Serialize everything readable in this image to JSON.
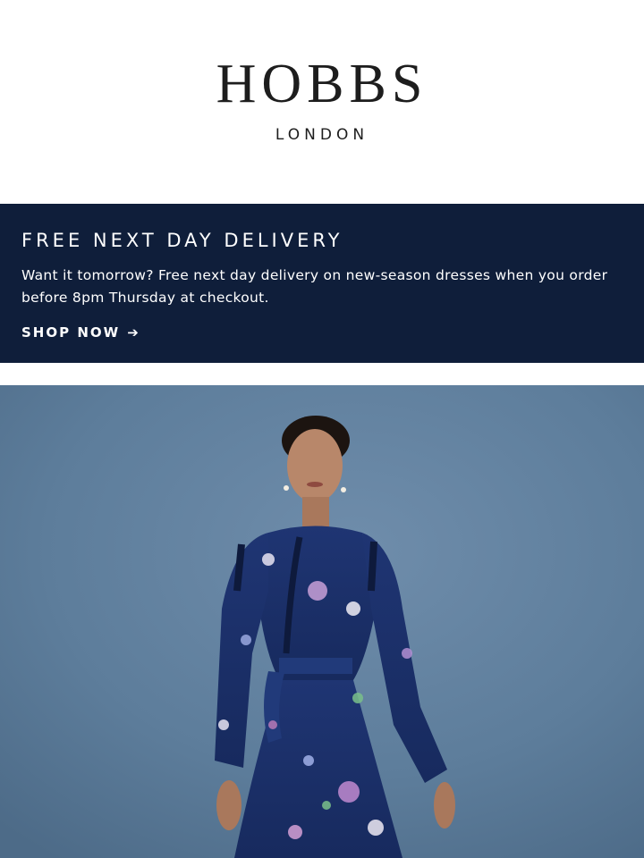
{
  "header": {
    "brand": "HOBBS",
    "brand_sub": "LONDON"
  },
  "promo": {
    "title": "FREE NEXT DAY DELIVERY",
    "body": "Want it tomorrow? Free next day delivery on new-season dresses when you order before 8pm Thursday at checkout.",
    "cta_label": "SHOP NOW",
    "cta_icon": "arrow-right-icon"
  },
  "hero": {
    "subject": "model-in-floral-dress-image"
  },
  "colors": {
    "banner_bg": "#0f1e3a",
    "hero_bg": "#5f7f9c",
    "dress": "#1b2f6b"
  }
}
